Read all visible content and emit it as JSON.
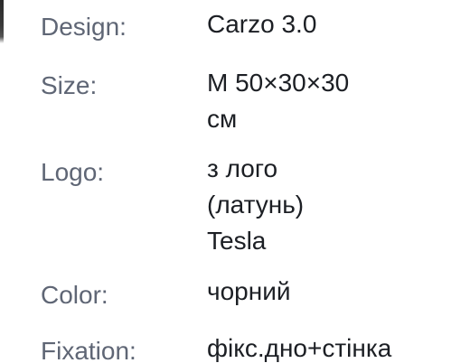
{
  "specs": [
    {
      "label": "Design:",
      "value_lines": [
        "Carzo 3.0"
      ]
    },
    {
      "label": "Size:",
      "value_lines": [
        "M 50×30×30",
        "см"
      ]
    },
    {
      "label": "Logo:",
      "value_lines": [
        "з лого",
        "(латунь)",
        "Tesla"
      ]
    },
    {
      "label": "Color:",
      "value_lines": [
        "чорний"
      ]
    },
    {
      "label": "Fixation:",
      "value_lines": [
        "фікс.дно+стінка"
      ]
    }
  ]
}
